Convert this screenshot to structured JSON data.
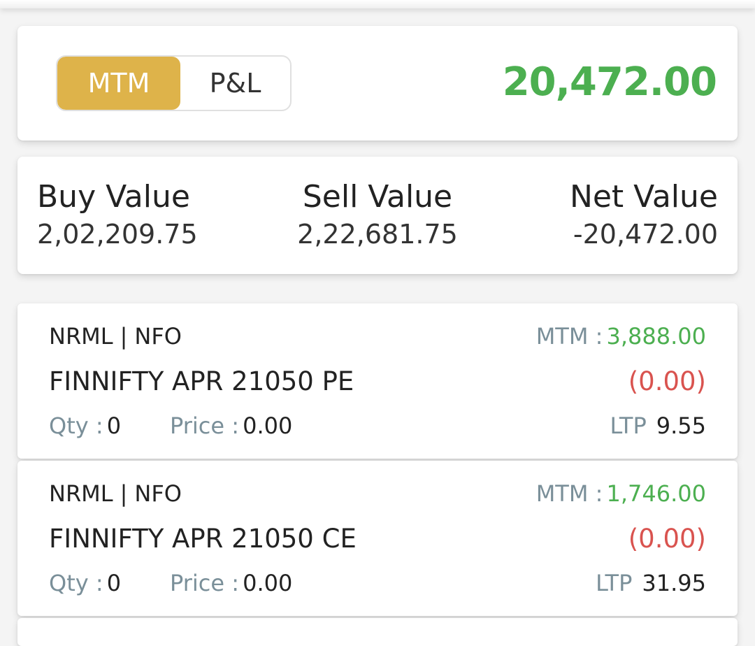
{
  "summary": {
    "toggle": {
      "active_label": "MTM",
      "inactive_label": "P&L"
    },
    "total_value": "20,472.00",
    "colors": {
      "accent": "#deb34a",
      "positive": "#4caf50",
      "negative": "#d9534f",
      "muted": "#7a8f99"
    }
  },
  "values": {
    "buy": {
      "label": "Buy Value",
      "value": "2,02,209.75"
    },
    "sell": {
      "label": "Sell Value",
      "value": "2,22,681.75"
    },
    "net": {
      "label": "Net Value",
      "value": "-20,472.00"
    }
  },
  "positions": [
    {
      "product": "NRML",
      "separator": "|",
      "exchange": "NFO",
      "mtm_label": "MTM :",
      "mtm_value": "3,888.00",
      "symbol": "FINNIFTY APR 21050 PE",
      "pnl": "(0.00)",
      "qty_label": "Qty :",
      "qty": "0",
      "price_label": "Price :",
      "price": "0.00",
      "ltp_label": "LTP",
      "ltp": "9.55"
    },
    {
      "product": "NRML",
      "separator": "|",
      "exchange": "NFO",
      "mtm_label": "MTM :",
      "mtm_value": "1,746.00",
      "symbol": "FINNIFTY APR 21050 CE",
      "pnl": "(0.00)",
      "qty_label": "Qty :",
      "qty": "0",
      "price_label": "Price :",
      "price": "0.00",
      "ltp_label": "LTP",
      "ltp": "31.95"
    }
  ]
}
